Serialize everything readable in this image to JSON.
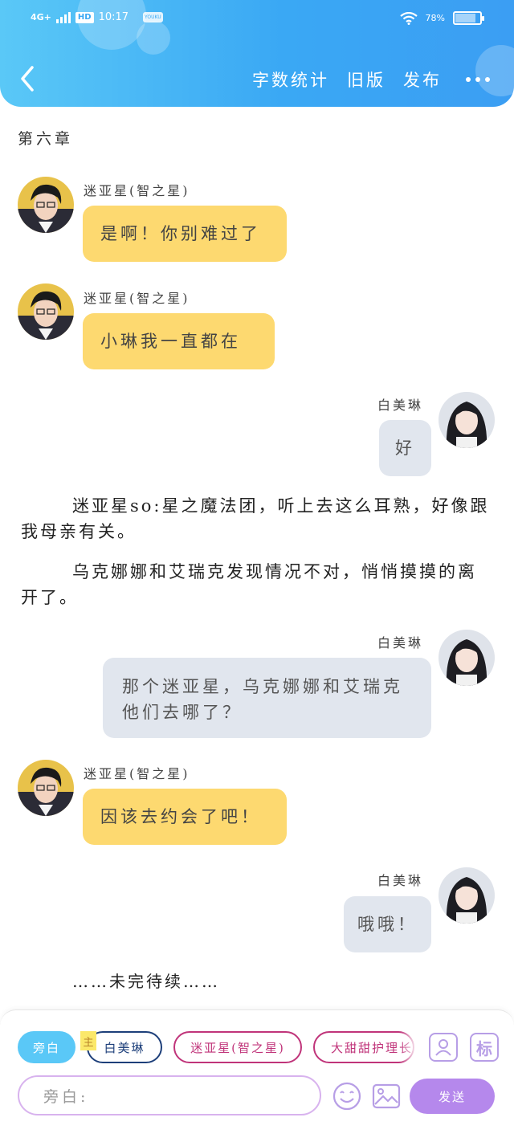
{
  "status_bar": {
    "network": "4G+",
    "hd": "HD",
    "time": "10:17",
    "app_badge": "YOUKU",
    "battery": "78%"
  },
  "nav": {
    "word_count": "字数统计",
    "old_version": "旧版",
    "publish": "发布"
  },
  "chapter_title": "第六章",
  "messages": [
    {
      "sender": "迷亚星(智之星)",
      "text": "是啊！你别难过了"
    },
    {
      "sender": "迷亚星(智之星)",
      "text": "小琳我一直都在"
    },
    {
      "sender": "白美琳",
      "text": "好"
    },
    {
      "sender": "白美琳",
      "text": "那个迷亚星，乌克娜娜和艾瑞克他们去哪了？"
    },
    {
      "sender": "迷亚星(智之星)",
      "text": "因该去约会了吧！"
    },
    {
      "sender": "白美琳",
      "text": "哦哦！"
    }
  ],
  "narration": [
    "迷亚星so:星之魔法团，听上去这么耳熟，好像跟我母亲有关。",
    "乌克娜娜和艾瑞克发现情况不对，悄悄摸摸的离开了。"
  ],
  "to_be_continued": "……未完待续……",
  "composer": {
    "roles": [
      "旁白",
      "白美琳",
      "迷亚星(智之星)",
      "大甜甜护理长"
    ],
    "main_tag": "主",
    "mark_label": "标",
    "input_placeholder": "旁白:",
    "send_label": "发送"
  },
  "colors": {
    "header": "#3aa8f4",
    "bubble_left": "#fdd970",
    "bubble_right": "#e1e6ee",
    "send": "#b588ec"
  }
}
